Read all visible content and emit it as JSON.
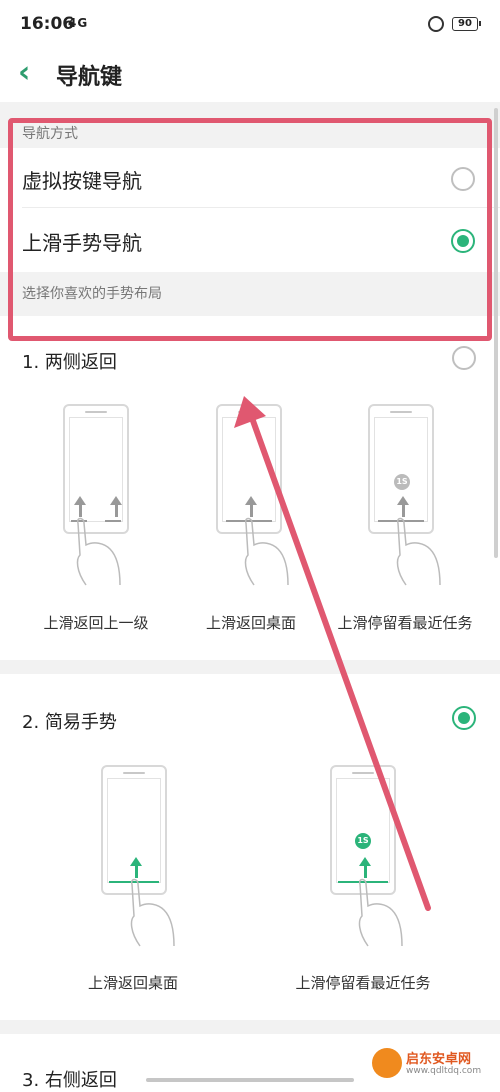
{
  "status_bar": {
    "time": "16:06",
    "signal": "4G",
    "battery": "90"
  },
  "header": {
    "title": "导航键"
  },
  "nav_mode": {
    "section_label": "导航方式",
    "options": [
      {
        "label": "虚拟按键导航",
        "selected": false
      },
      {
        "label": "上滑手势导航",
        "selected": true
      }
    ]
  },
  "gesture_layout": {
    "section_label": "选择你喜欢的手势布局",
    "groups": [
      {
        "title": "1. 两侧返回",
        "selected": false,
        "captions": [
          "上滑返回上一级",
          "上滑返回桌面",
          "上滑停留看最近任务"
        ]
      },
      {
        "title": "2. 简易手势",
        "selected": true,
        "captions": [
          "上滑返回桌面",
          "上滑停留看最近任务"
        ]
      },
      {
        "title": "3. 右侧返回",
        "selected": false,
        "captions": []
      }
    ],
    "badge_text": "1S"
  },
  "watermark": {
    "name": "启东安卓网",
    "url": "www.qdltdq.com"
  },
  "colors": {
    "accent": "#2bb47a",
    "annotation": "#e05870",
    "back_arrow": "#2e9d6f"
  }
}
